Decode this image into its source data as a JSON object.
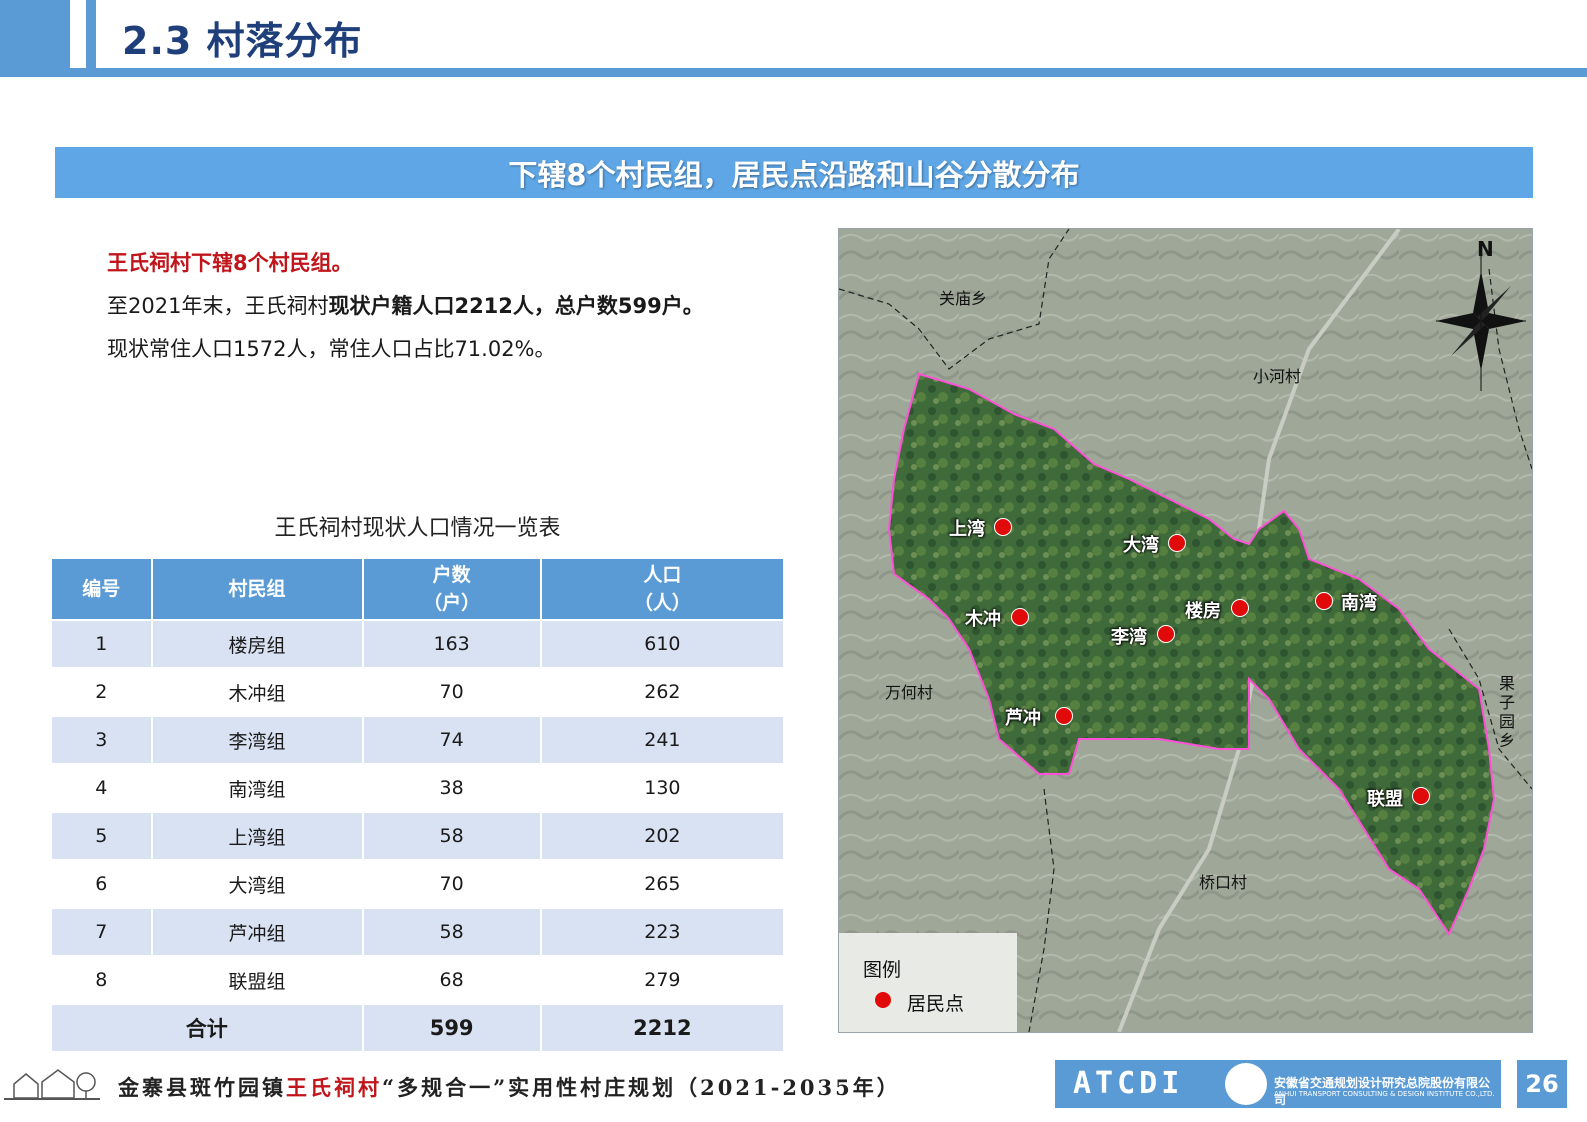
{
  "header": {
    "title": "2.3 村落分布"
  },
  "banner": {
    "text": "下辖8个村民组，居民点沿路和山谷分散分布"
  },
  "intro": {
    "line1": "王氏祠村下辖8个村民组。",
    "line2_a": "至2021年末，王氏祠村",
    "line2_b": "现状户籍人口2212人，总户数599户",
    "line2_c": "。",
    "line3": "现状常住人口1572人，常住人口占比71.02%。"
  },
  "table": {
    "title": "王氏祠村现状人口情况一览表",
    "headers": {
      "id": "编号",
      "group": "村民组",
      "households": "户数",
      "households_unit": "（户）",
      "population": "人口",
      "population_unit": "（人）"
    },
    "rows": [
      {
        "id": "1",
        "group": "楼房组",
        "households": "163",
        "population": "610"
      },
      {
        "id": "2",
        "group": "木冲组",
        "households": "70",
        "population": "262"
      },
      {
        "id": "3",
        "group": "李湾组",
        "households": "74",
        "population": "241"
      },
      {
        "id": "4",
        "group": "南湾组",
        "households": "38",
        "population": "130"
      },
      {
        "id": "5",
        "group": "上湾组",
        "households": "58",
        "population": "202"
      },
      {
        "id": "6",
        "group": "大湾组",
        "households": "70",
        "population": "265"
      },
      {
        "id": "7",
        "group": "芦冲组",
        "households": "58",
        "population": "223"
      },
      {
        "id": "8",
        "group": "联盟组",
        "households": "68",
        "population": "279"
      }
    ],
    "total": {
      "label": "合计",
      "households": "599",
      "population": "2212"
    }
  },
  "map": {
    "north_label": "N",
    "region_labels": {
      "guanmiao": "关庙乡",
      "xiaohe": "小河村",
      "wanhe": "万何村",
      "qiaokou": "桥口村",
      "guoyuan": "果子园乡"
    },
    "settlements": {
      "shangwan": "上湾",
      "dawan": "大湾",
      "loufang": "楼房",
      "nanwan": "南湾",
      "muchong": "木冲",
      "liwan": "李湾",
      "luchong": "芦冲",
      "lianmeng": "联盟"
    },
    "legend": {
      "title": "图例",
      "item": "居民点"
    },
    "colors": {
      "boundary": "#ff4fd8",
      "settlement": "#e00a0a"
    }
  },
  "footer": {
    "text_a": "金寨县斑竹园镇",
    "text_red": "王氏祠村",
    "text_b": "“多规合一”实用性村庄规划（2021-2035年）",
    "logo_word": "ATCDI",
    "logo_cn": "安徽省交通规划设计研究总院股份有限公司",
    "logo_en": "ANHUI TRANSPORT CONSULTING & DESIGN INSTITUTE CO.,LTD.",
    "page_number": "26"
  }
}
